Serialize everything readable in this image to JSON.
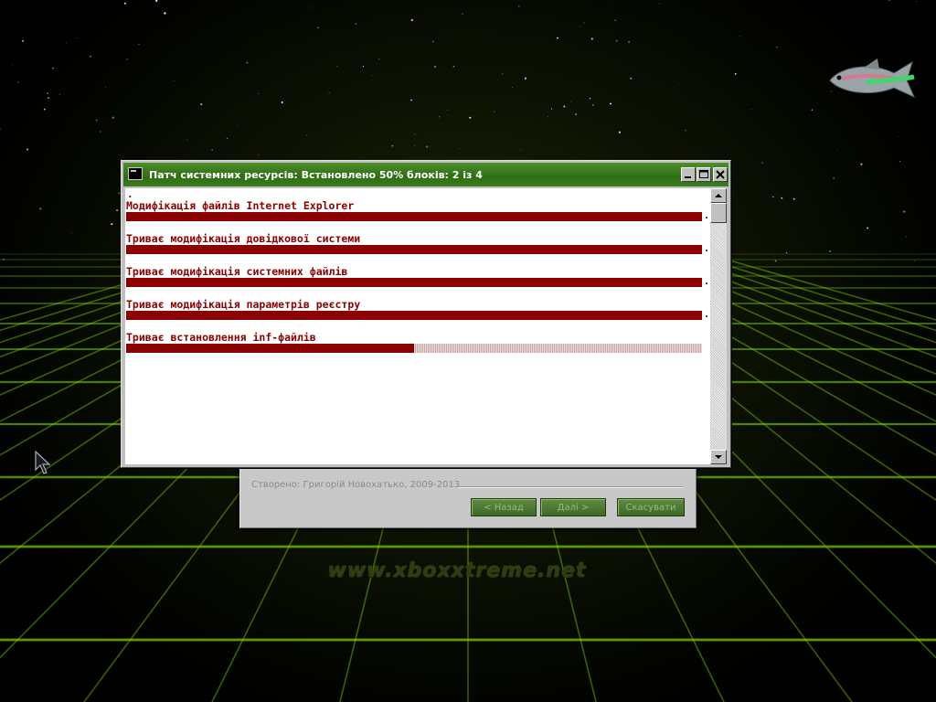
{
  "desktop": {
    "watermark": "www.xboxxtreme.net",
    "grid_color": "#7fd000"
  },
  "installer": {
    "credit": "Створено: Григорій Новохатько, 2009-2013",
    "back_label": "< Назад",
    "next_label": "Далі >",
    "cancel_label": "Скасувати"
  },
  "console": {
    "title": "Патч системних ресурсів:  Встановлено 50%  блоків: 2 із 4",
    "top_marker": ".",
    "text_color": "#8b0000",
    "tasks": [
      {
        "label": "Модифікація файлів Internet Explorer",
        "progress": 1.0,
        "done_marker": "."
      },
      {
        "label": "Триває модифікація довідкової системи",
        "progress": 1.0,
        "done_marker": "."
      },
      {
        "label": "Триває модифікація системних файлів",
        "progress": 1.0,
        "done_marker": "."
      },
      {
        "label": "Триває модифікація параметрів реєстру",
        "progress": 1.0,
        "done_marker": "."
      },
      {
        "label": "Триває встановлення inf-файлів",
        "progress": 0.5,
        "done_marker": ""
      }
    ]
  },
  "icons": {
    "window_icon": "console-window-icon",
    "minimize": "minimize-icon",
    "maximize": "maximize-icon",
    "close": "close-icon",
    "scroll_up": "scroll-up-arrow-icon",
    "scroll_down": "scroll-down-arrow-icon"
  }
}
